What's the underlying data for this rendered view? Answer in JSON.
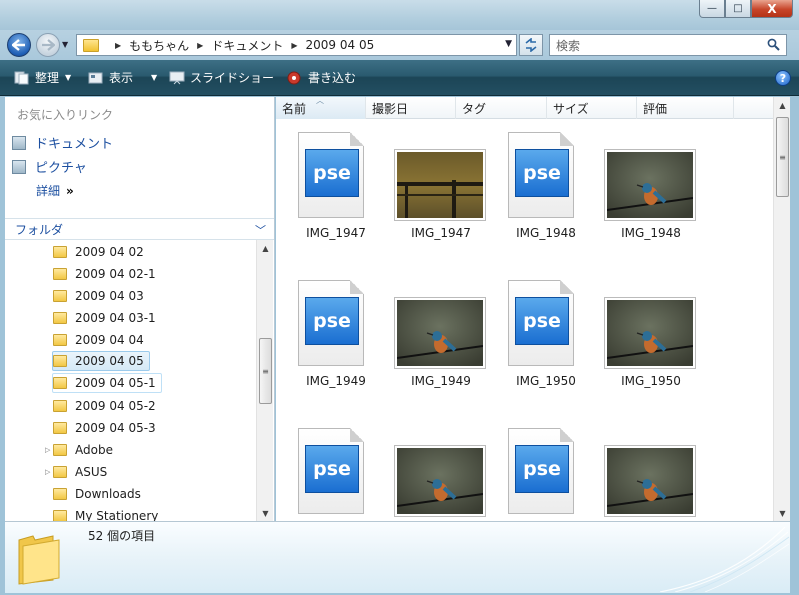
{
  "window": {
    "minimize_label": "—",
    "maximize_label": "□",
    "close_label": "X"
  },
  "address": {
    "breadcrumbs": [
      "ももちゃん",
      "ドキュメント",
      "2009 04 05"
    ],
    "search_placeholder": "検索"
  },
  "toolbar": {
    "organize": "整理",
    "view": "表示",
    "slideshow": "スライドショー",
    "burn": "書き込む"
  },
  "favorites": {
    "title": "お気に入りリンク",
    "items": [
      "ドキュメント",
      "ピクチャ"
    ],
    "more": "詳細",
    "more_chevron": "»"
  },
  "folders": {
    "header": "フォルダ",
    "items": [
      "2009 04 02",
      "2009 04 02-1",
      "2009 04 03",
      "2009 04 03-1",
      "2009 04 04",
      "2009 04 05",
      "2009 04 05-1",
      "2009 04 05-2",
      "2009 04 05-3",
      "Adobe",
      "ASUS",
      "Downloads",
      "My Stationery"
    ],
    "selected": "2009 04 05"
  },
  "columns": [
    "名前",
    "撮影日",
    "タグ",
    "サイズ",
    "評価"
  ],
  "files": [
    {
      "name": "IMG_1947",
      "kind": "pse"
    },
    {
      "name": "IMG_1947",
      "kind": "photo-fence"
    },
    {
      "name": "IMG_1948",
      "kind": "pse"
    },
    {
      "name": "IMG_1948",
      "kind": "photo-bird"
    },
    {
      "name": "IMG_1949",
      "kind": "pse"
    },
    {
      "name": "IMG_1949",
      "kind": "photo-bird"
    },
    {
      "name": "IMG_1950",
      "kind": "pse"
    },
    {
      "name": "IMG_1950",
      "kind": "photo-bird"
    },
    {
      "name": "",
      "kind": "pse"
    },
    {
      "name": "",
      "kind": "photo-bird"
    },
    {
      "name": "",
      "kind": "pse"
    },
    {
      "name": "",
      "kind": "photo-bird"
    }
  ],
  "pse_label": "pse",
  "status": {
    "item_count": "52 個の項目"
  },
  "help_label": "?"
}
